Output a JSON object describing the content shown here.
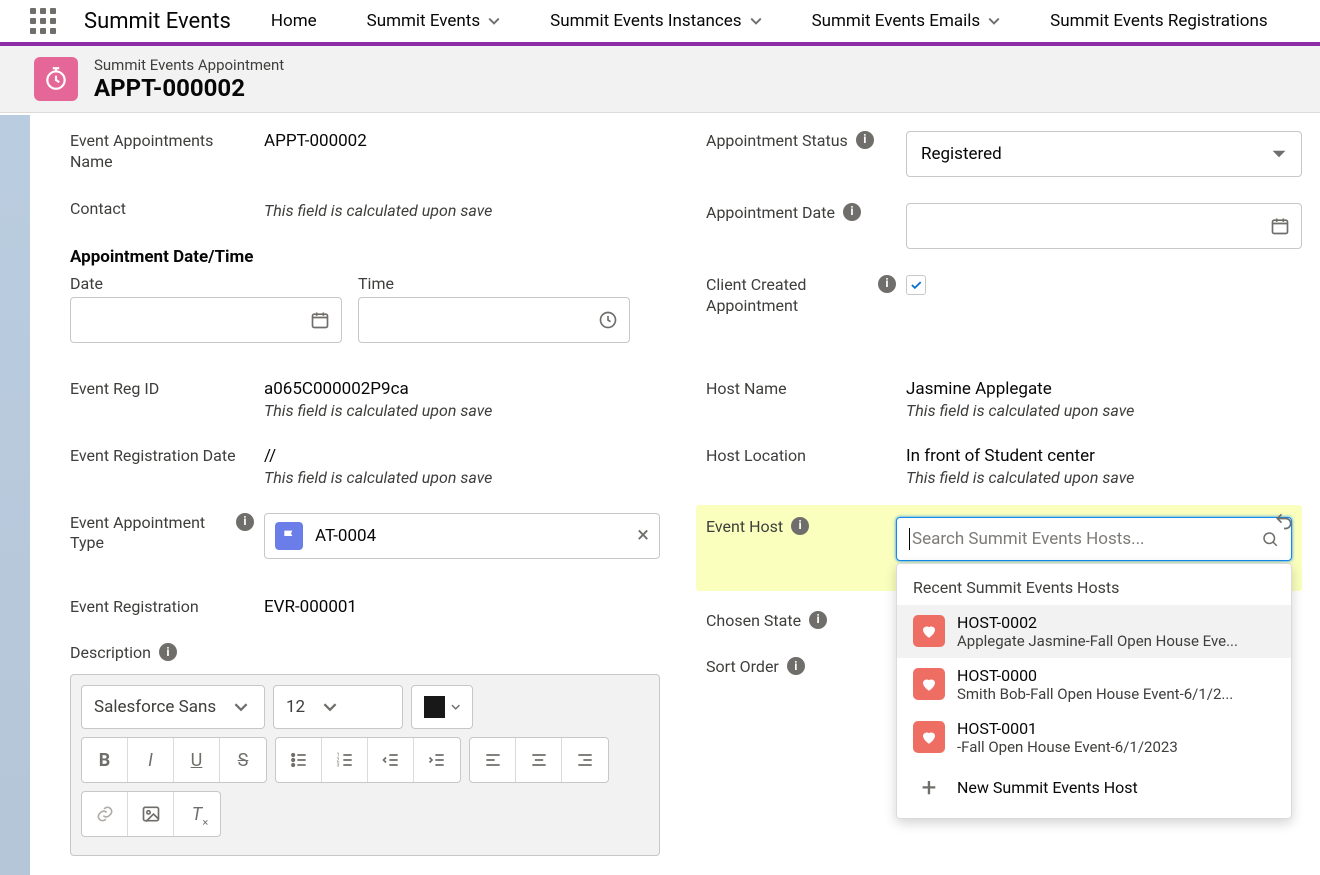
{
  "nav": {
    "app_name": "Summit Events",
    "items": [
      "Home",
      "Summit Events",
      "Summit Events Instances",
      "Summit Events Emails",
      "Summit Events Registrations"
    ]
  },
  "header": {
    "object_label": "Summit Events Appointment",
    "record_title": "APPT-000002"
  },
  "left": {
    "fields": {
      "event_appointments_name_label": "Event Appointments Name",
      "event_appointments_name_value": "APPT-000002",
      "contact_label": "Contact",
      "contact_hint": "This field is calculated upon save",
      "dt_section_label": "Appointment Date/Time",
      "date_label": "Date",
      "time_label": "Time",
      "event_reg_id_label": "Event Reg ID",
      "event_reg_id_value": "a065C000002P9ca",
      "event_reg_id_hint": "This field is calculated upon save",
      "event_registration_date_label": "Event Registration Date",
      "event_registration_date_value": "//",
      "event_registration_date_hint": "This field is calculated upon save",
      "event_appointment_type_label": "Event Appointment Type",
      "event_appointment_type_value": "AT-0004",
      "event_registration_label": "Event Registration",
      "event_registration_value": "EVR-000001",
      "description_label": "Description"
    },
    "rte": {
      "font": "Salesforce Sans",
      "size": "12"
    }
  },
  "right": {
    "fields": {
      "appointment_status_label": "Appointment Status",
      "appointment_status_value": "Registered",
      "appointment_date_label": "Appointment Date",
      "client_created_label": "Client Created Appointment",
      "host_name_label": "Host Name",
      "host_name_value": "Jasmine Applegate",
      "host_name_hint": "This field is calculated upon save",
      "host_location_label": "Host Location",
      "host_location_value": "In front of Student center",
      "host_location_hint": "This field is calculated upon save",
      "event_host_label": "Event Host",
      "event_host_placeholder": "Search Summit Events Hosts...",
      "chosen_state_label": "Chosen State",
      "sort_order_label": "Sort Order"
    },
    "dropdown": {
      "header": "Recent Summit Events Hosts",
      "items": [
        {
          "title": "HOST-0002",
          "sub": "Applegate Jasmine-Fall Open House Eve..."
        },
        {
          "title": "HOST-0000",
          "sub": "Smith Bob-Fall Open House Event-6/1/2..."
        },
        {
          "title": "HOST-0001",
          "sub": "-Fall Open House Event-6/1/2023"
        }
      ],
      "new_label": "New Summit Events Host"
    }
  }
}
